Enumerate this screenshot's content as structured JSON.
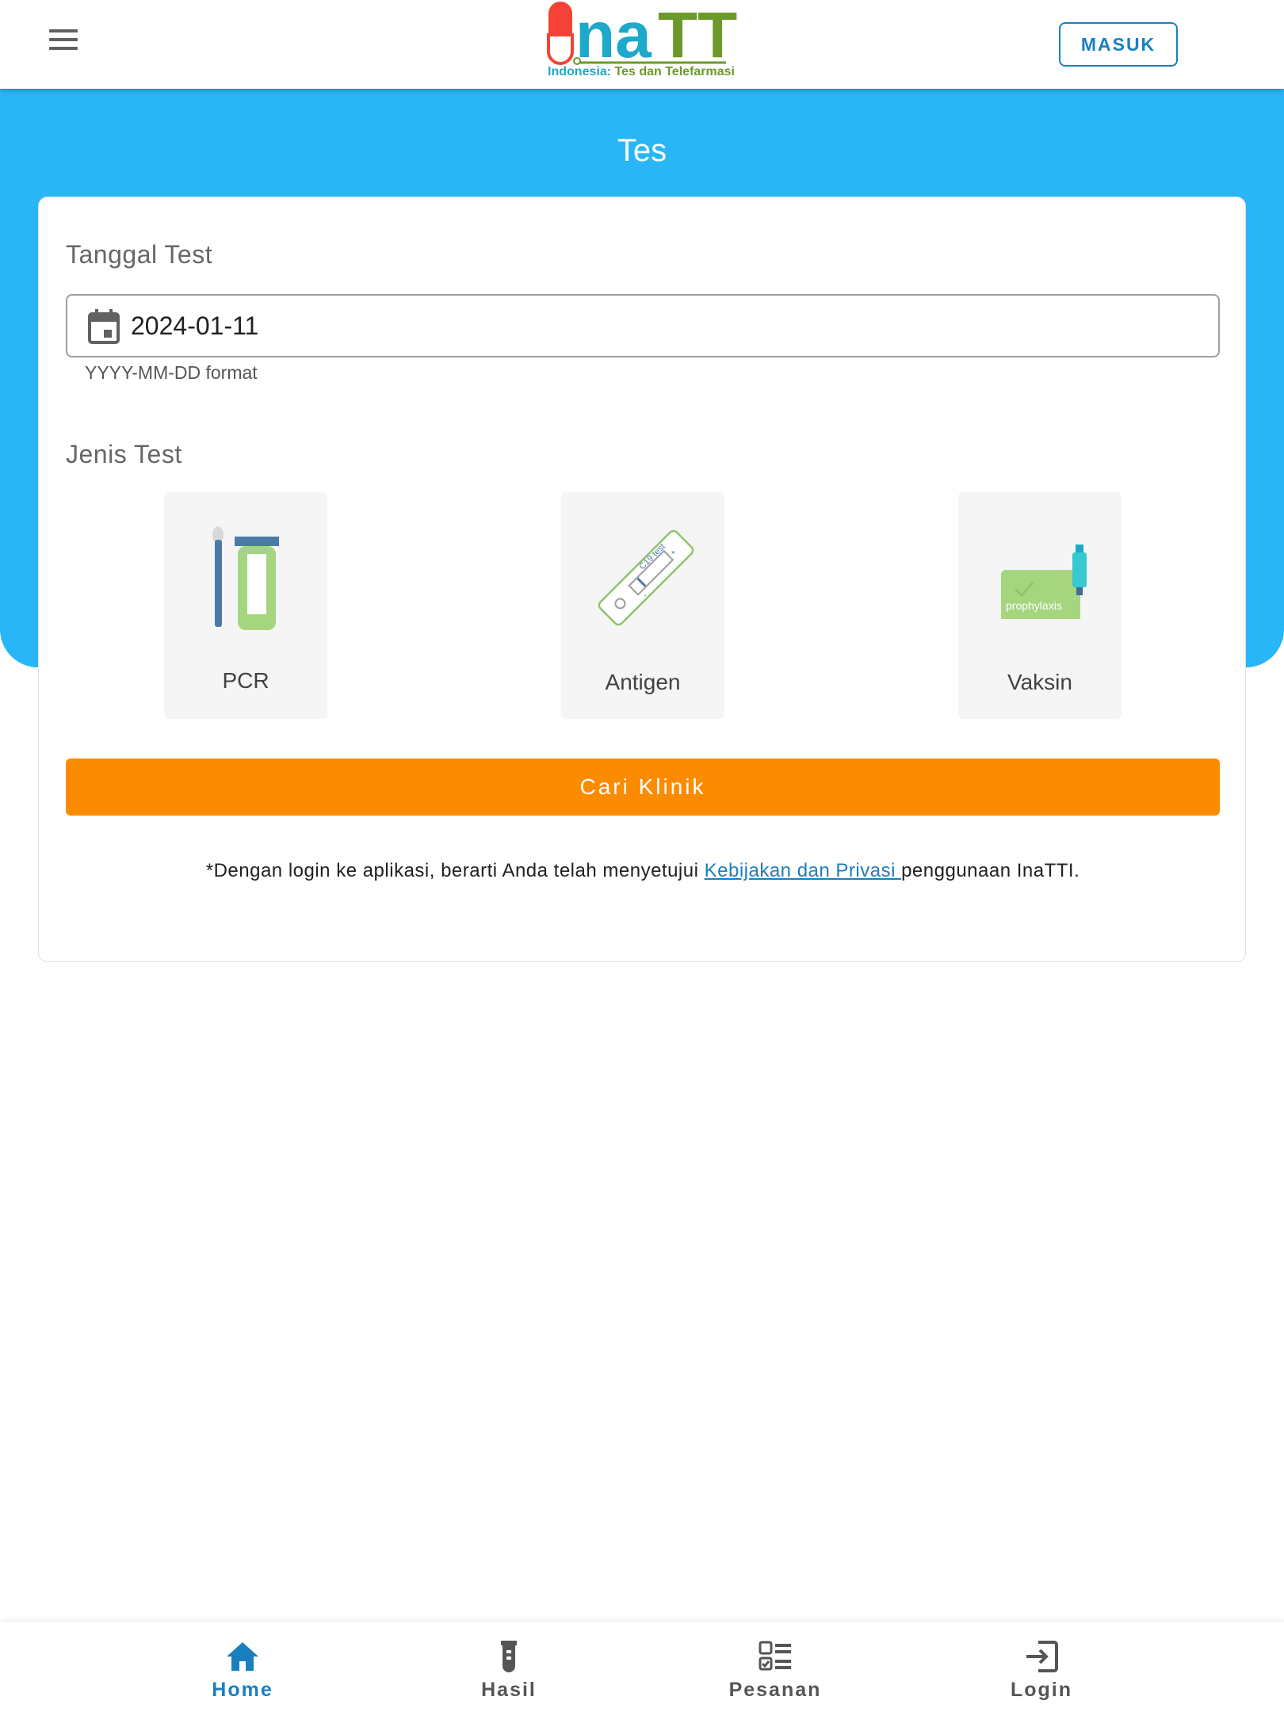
{
  "header": {
    "logo_text": "InaTTi",
    "logo_subtitle_a": "Indonesia: ",
    "logo_subtitle_b": "Tes dan Telefarmasi",
    "login_button": "MASUK"
  },
  "page": {
    "title": "Tes"
  },
  "form": {
    "date_label": "Tanggal Test",
    "date_value": "2024-01-11",
    "date_hint": "YYYY-MM-DD format",
    "type_label": "Jenis Test",
    "types": [
      {
        "label": "PCR",
        "icon": "pcr-tube-icon"
      },
      {
        "label": "Antigen",
        "icon": "antigen-test-icon"
      },
      {
        "label": "Vaksin",
        "icon": "vaccine-icon",
        "icon_text": "prophylaxis"
      }
    ],
    "antigen_icon_text": "C19 test",
    "submit_label": "Cari Klinik",
    "disclaimer_prefix": "*Dengan login ke aplikasi, berarti Anda telah menyetujui ",
    "disclaimer_link": "Kebijakan dan Privasi ",
    "disclaimer_suffix": "penggunaan InaTTI."
  },
  "bottom_nav": {
    "items": [
      {
        "label": "Home",
        "icon": "home-icon",
        "active": true
      },
      {
        "label": "Hasil",
        "icon": "test-tube-icon",
        "active": false
      },
      {
        "label": "Pesanan",
        "icon": "checklist-icon",
        "active": false
      },
      {
        "label": "Login",
        "icon": "login-icon",
        "active": false
      }
    ]
  },
  "colors": {
    "primary_band": "#29b6f6",
    "accent_orange": "#fb8c00",
    "link_blue": "#1a7fbf",
    "logo_red": "#f44336",
    "logo_teal": "#1ea8c9",
    "logo_green": "#6b9a2b"
  }
}
